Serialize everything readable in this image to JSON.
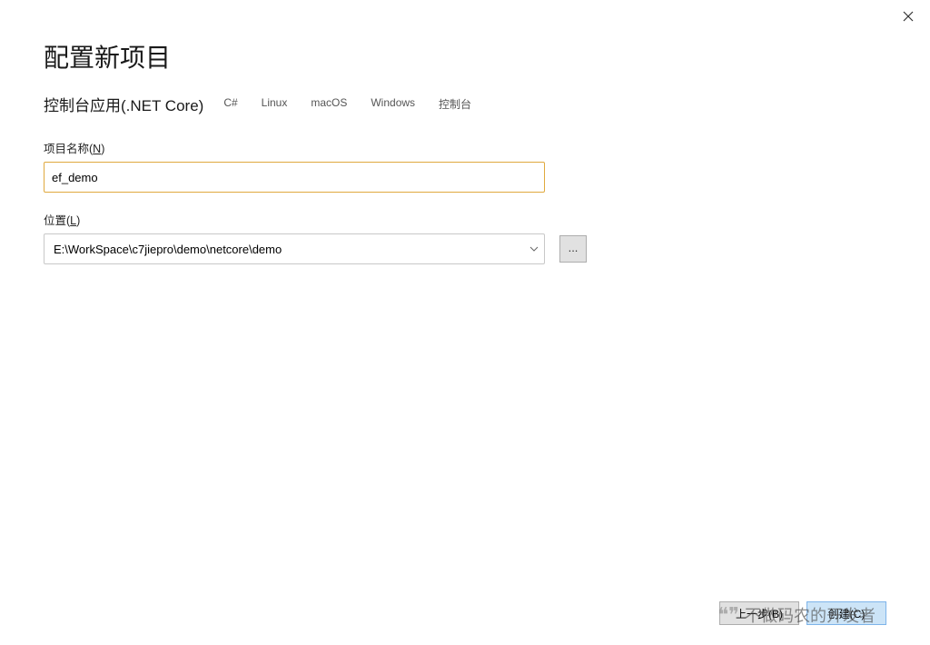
{
  "window": {
    "close_tooltip": "关闭"
  },
  "page": {
    "title": "配置新项目",
    "subtitle": "控制台应用(.NET Core)",
    "tags": [
      "C#",
      "Linux",
      "macOS",
      "Windows",
      "控制台"
    ]
  },
  "fields": {
    "project_name": {
      "label_prefix": "项目名称(",
      "label_hotkey": "N",
      "label_suffix": ")",
      "value": "ef_demo"
    },
    "location": {
      "label_prefix": "位置(",
      "label_hotkey": "L",
      "label_suffix": ")",
      "value": "E:\\WorkSpace\\c7jiepro\\demo\\netcore\\demo",
      "browse_label": "..."
    }
  },
  "footer": {
    "back_label": "上一步(B)",
    "create_label": "创建(C)"
  },
  "watermark": {
    "text": "不做码农的开发者"
  }
}
